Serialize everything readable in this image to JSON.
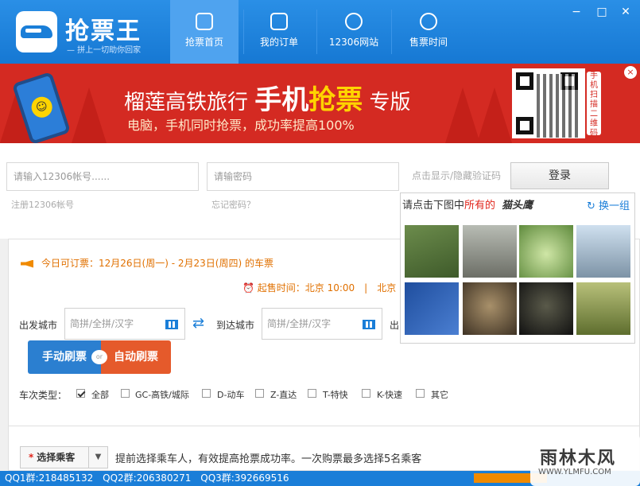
{
  "header": {
    "brand": "抢票王",
    "slogan": "— 拼上一切助你回家",
    "nav": [
      {
        "label": "抢票首页",
        "icon": "train-icon",
        "active": true
      },
      {
        "label": "我的订单",
        "icon": "checkbox-icon",
        "active": false
      },
      {
        "label": "12306网站",
        "icon": "globe-icon",
        "active": false
      },
      {
        "label": "售票时间",
        "icon": "clock-icon",
        "active": false
      }
    ],
    "window": {
      "minimize": "−",
      "maximize": "□",
      "close": "✕"
    }
  },
  "banner": {
    "line1_a": "榴莲高铁旅行",
    "line1_b": "手机",
    "line1_c": "抢票",
    "line1_d": "专版",
    "line2": "电脑，手机同时抢票，成功率提高100%",
    "qr_tag": "手机扫描二维码",
    "close": "×"
  },
  "login": {
    "account_placeholder": "请输入12306帐号......",
    "password_placeholder": "请输密码",
    "register_link": "注册12306帐号",
    "forgot_link": "忘记密码？",
    "captcha_toggle": "点击显示/隐藏验证码",
    "login_button": "登录"
  },
  "captcha": {
    "prompt_a": "请点击下图中",
    "prompt_b": "所有的",
    "target": "猫头鹰",
    "refresh": "换一组",
    "images": [
      "bamboo-image",
      "bridge-image",
      "cabbage-image",
      "arch-bridge-image",
      "playing-card-image",
      "owl-image",
      "owl-dark-image",
      "kangaroo-image"
    ],
    "colors": [
      "#5a7a3a",
      "#8a8c86",
      "#7aa95a",
      "#9ab4cc",
      "#2f5fb4",
      "#6b5a44",
      "#2a2a22",
      "#8a9a4a"
    ]
  },
  "booking": {
    "notice": "今日可订票：12月26日(周一) - 2月23日(周四) 的车票",
    "sale_time": "起售时间：北京 10:00　|　北京",
    "from_label": "出发城市",
    "from_placeholder": "简拼/全拼/汉字",
    "to_label": "到达城市",
    "to_placeholder": "简拼/全拼/汉字",
    "date_label": "出",
    "manual_button": "手动刷票",
    "or": "or",
    "auto_button": "自动刷票",
    "train_type_label": "车次类型：",
    "train_types": [
      {
        "label": "全部",
        "checked": true
      },
      {
        "label": "GC-高铁/城际",
        "checked": false
      },
      {
        "label": "D-动车",
        "checked": false
      },
      {
        "label": "Z-直达",
        "checked": false
      },
      {
        "label": "T-特快",
        "checked": false
      },
      {
        "label": "K-快速",
        "checked": false
      },
      {
        "label": "其它",
        "checked": false
      }
    ]
  },
  "passenger": {
    "button": "选择乘客",
    "star": "*",
    "tip": "提前选择乘车人，有效提高抢票成功率。一次购票最多选择5名乘客"
  },
  "footer": {
    "qq1": "QQ1群:218485132",
    "qq2": "QQ2群:206380271",
    "qq3": "QQ3群:392669516"
  },
  "watermark": {
    "line1": "雨林木风",
    "line2": "WWW.YLMFU.COM"
  },
  "colors": {
    "header": "#1a7ed8",
    "banner": "#d42a22",
    "manual": "#2b7fd0",
    "auto": "#e55a2b",
    "notice": "#e07000"
  }
}
